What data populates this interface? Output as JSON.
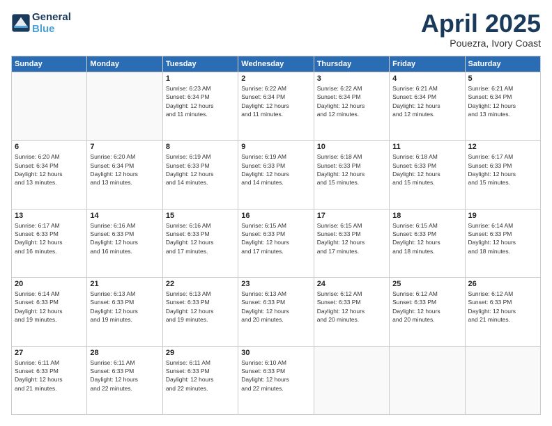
{
  "header": {
    "logo_line1": "General",
    "logo_line2": "Blue",
    "month_title": "April 2025",
    "location": "Pouezra, Ivory Coast"
  },
  "weekdays": [
    "Sunday",
    "Monday",
    "Tuesday",
    "Wednesday",
    "Thursday",
    "Friday",
    "Saturday"
  ],
  "weeks": [
    [
      {
        "day": "",
        "info": ""
      },
      {
        "day": "",
        "info": ""
      },
      {
        "day": "1",
        "info": "Sunrise: 6:23 AM\nSunset: 6:34 PM\nDaylight: 12 hours\nand 11 minutes."
      },
      {
        "day": "2",
        "info": "Sunrise: 6:22 AM\nSunset: 6:34 PM\nDaylight: 12 hours\nand 11 minutes."
      },
      {
        "day": "3",
        "info": "Sunrise: 6:22 AM\nSunset: 6:34 PM\nDaylight: 12 hours\nand 12 minutes."
      },
      {
        "day": "4",
        "info": "Sunrise: 6:21 AM\nSunset: 6:34 PM\nDaylight: 12 hours\nand 12 minutes."
      },
      {
        "day": "5",
        "info": "Sunrise: 6:21 AM\nSunset: 6:34 PM\nDaylight: 12 hours\nand 13 minutes."
      }
    ],
    [
      {
        "day": "6",
        "info": "Sunrise: 6:20 AM\nSunset: 6:34 PM\nDaylight: 12 hours\nand 13 minutes."
      },
      {
        "day": "7",
        "info": "Sunrise: 6:20 AM\nSunset: 6:34 PM\nDaylight: 12 hours\nand 13 minutes."
      },
      {
        "day": "8",
        "info": "Sunrise: 6:19 AM\nSunset: 6:33 PM\nDaylight: 12 hours\nand 14 minutes."
      },
      {
        "day": "9",
        "info": "Sunrise: 6:19 AM\nSunset: 6:33 PM\nDaylight: 12 hours\nand 14 minutes."
      },
      {
        "day": "10",
        "info": "Sunrise: 6:18 AM\nSunset: 6:33 PM\nDaylight: 12 hours\nand 15 minutes."
      },
      {
        "day": "11",
        "info": "Sunrise: 6:18 AM\nSunset: 6:33 PM\nDaylight: 12 hours\nand 15 minutes."
      },
      {
        "day": "12",
        "info": "Sunrise: 6:17 AM\nSunset: 6:33 PM\nDaylight: 12 hours\nand 15 minutes."
      }
    ],
    [
      {
        "day": "13",
        "info": "Sunrise: 6:17 AM\nSunset: 6:33 PM\nDaylight: 12 hours\nand 16 minutes."
      },
      {
        "day": "14",
        "info": "Sunrise: 6:16 AM\nSunset: 6:33 PM\nDaylight: 12 hours\nand 16 minutes."
      },
      {
        "day": "15",
        "info": "Sunrise: 6:16 AM\nSunset: 6:33 PM\nDaylight: 12 hours\nand 17 minutes."
      },
      {
        "day": "16",
        "info": "Sunrise: 6:15 AM\nSunset: 6:33 PM\nDaylight: 12 hours\nand 17 minutes."
      },
      {
        "day": "17",
        "info": "Sunrise: 6:15 AM\nSunset: 6:33 PM\nDaylight: 12 hours\nand 17 minutes."
      },
      {
        "day": "18",
        "info": "Sunrise: 6:15 AM\nSunset: 6:33 PM\nDaylight: 12 hours\nand 18 minutes."
      },
      {
        "day": "19",
        "info": "Sunrise: 6:14 AM\nSunset: 6:33 PM\nDaylight: 12 hours\nand 18 minutes."
      }
    ],
    [
      {
        "day": "20",
        "info": "Sunrise: 6:14 AM\nSunset: 6:33 PM\nDaylight: 12 hours\nand 19 minutes."
      },
      {
        "day": "21",
        "info": "Sunrise: 6:13 AM\nSunset: 6:33 PM\nDaylight: 12 hours\nand 19 minutes."
      },
      {
        "day": "22",
        "info": "Sunrise: 6:13 AM\nSunset: 6:33 PM\nDaylight: 12 hours\nand 19 minutes."
      },
      {
        "day": "23",
        "info": "Sunrise: 6:13 AM\nSunset: 6:33 PM\nDaylight: 12 hours\nand 20 minutes."
      },
      {
        "day": "24",
        "info": "Sunrise: 6:12 AM\nSunset: 6:33 PM\nDaylight: 12 hours\nand 20 minutes."
      },
      {
        "day": "25",
        "info": "Sunrise: 6:12 AM\nSunset: 6:33 PM\nDaylight: 12 hours\nand 20 minutes."
      },
      {
        "day": "26",
        "info": "Sunrise: 6:12 AM\nSunset: 6:33 PM\nDaylight: 12 hours\nand 21 minutes."
      }
    ],
    [
      {
        "day": "27",
        "info": "Sunrise: 6:11 AM\nSunset: 6:33 PM\nDaylight: 12 hours\nand 21 minutes."
      },
      {
        "day": "28",
        "info": "Sunrise: 6:11 AM\nSunset: 6:33 PM\nDaylight: 12 hours\nand 22 minutes."
      },
      {
        "day": "29",
        "info": "Sunrise: 6:11 AM\nSunset: 6:33 PM\nDaylight: 12 hours\nand 22 minutes."
      },
      {
        "day": "30",
        "info": "Sunrise: 6:10 AM\nSunset: 6:33 PM\nDaylight: 12 hours\nand 22 minutes."
      },
      {
        "day": "",
        "info": ""
      },
      {
        "day": "",
        "info": ""
      },
      {
        "day": "",
        "info": ""
      }
    ]
  ]
}
